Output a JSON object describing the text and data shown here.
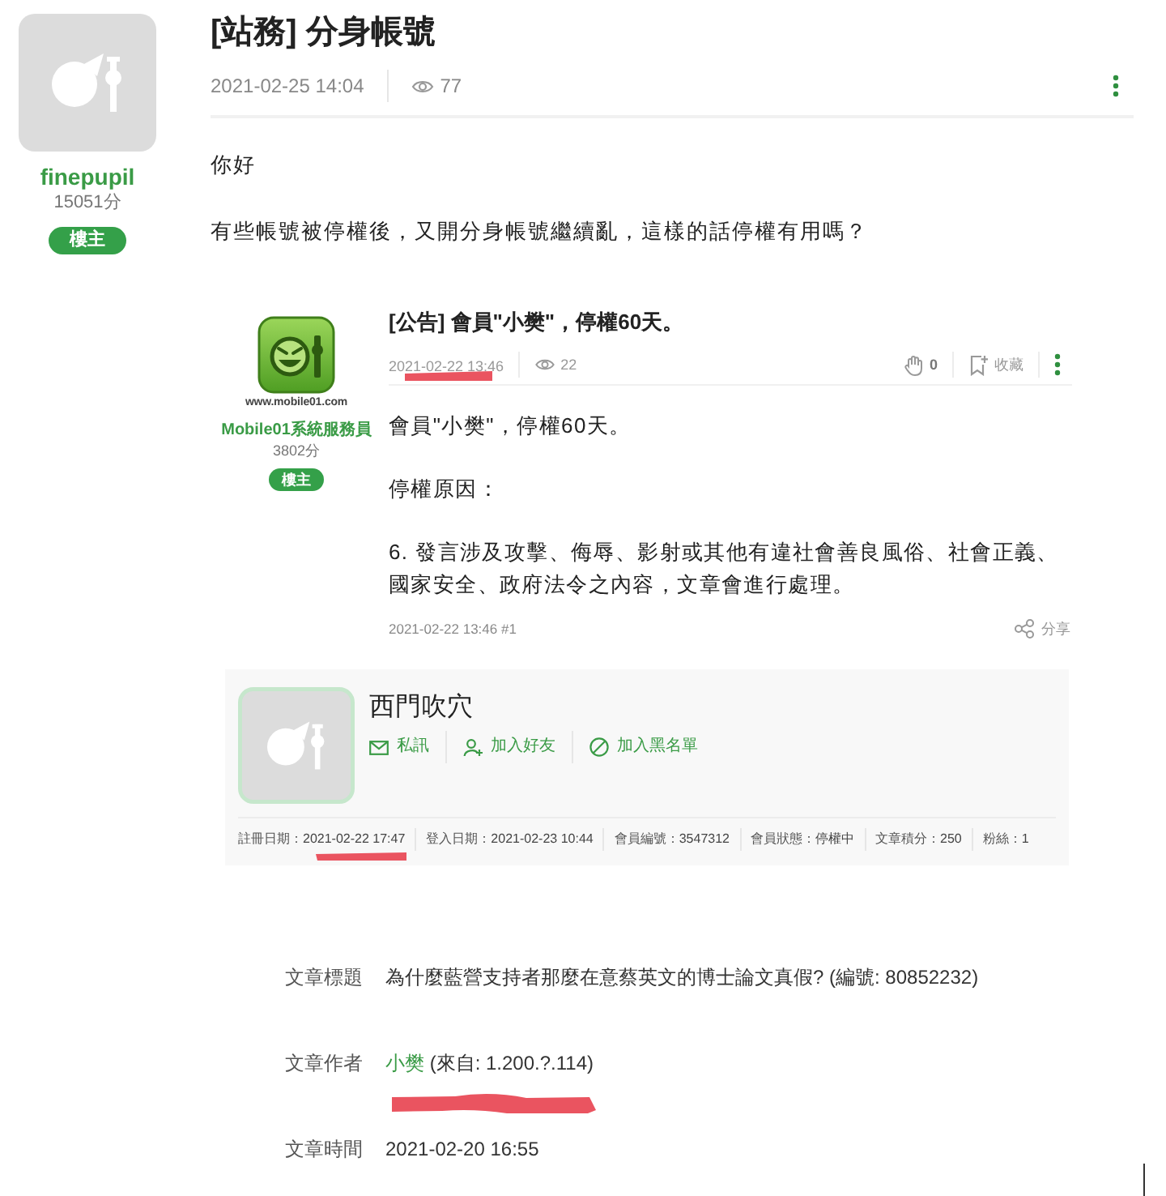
{
  "author": {
    "name": "finepupil",
    "points": "15051分",
    "badge": "樓主"
  },
  "post": {
    "title": "[站務] 分身帳號",
    "date": "2021-02-25 14:04",
    "views": "77",
    "paragraphs": [
      "你好",
      "有些帳號被停權後，又開分身帳號繼續亂，這樣的話停權有用嗎？"
    ]
  },
  "quoted_post": {
    "author": {
      "name": "Mobile01系統服務員",
      "logo_caption": "www.mobile01.com",
      "points": "3802分",
      "badge": "樓主"
    },
    "title": "[公告] 會員\"小樊\"，停權60天。",
    "date": "2021-02-22 13:46",
    "date_annotated": true,
    "views": "22",
    "likes": "0",
    "bookmark_label": "收藏",
    "paragraphs": [
      "會員\"小樊\"，停權60天。",
      "停權原因：",
      "6. 發言涉及攻擊、侮辱、影射或其他有違社會善良風俗、社會正義、國家安全、政府法令之內容，文章會進行處理。"
    ],
    "footer": "2021-02-22 13:46 #1",
    "share_label": "分享"
  },
  "profile_card": {
    "name": "西門吹穴",
    "actions": [
      {
        "kind": "message",
        "label": "私訊"
      },
      {
        "kind": "add_friend",
        "label": "加入好友"
      },
      {
        "kind": "block",
        "label": "加入黑名單"
      }
    ],
    "stats": [
      {
        "label": "註冊日期：",
        "value": "2021-02-22 17:47",
        "annotated": true
      },
      {
        "label": "登入日期：",
        "value": "2021-02-23 10:44",
        "annotated": false
      },
      {
        "label": "會員編號：",
        "value": "3547312",
        "annotated": false
      },
      {
        "label": "會員狀態：",
        "value": "停權中",
        "annotated": false
      },
      {
        "label": "文章積分：",
        "value": "250",
        "annotated": false
      },
      {
        "label": "粉絲：",
        "value": "1",
        "annotated": false
      }
    ]
  },
  "article_info": [
    {
      "kind": "text",
      "label": "文章標題",
      "value": "為什麼藍營支持者那麼在意蔡英文的博士論文真假? (編號: 80852232)",
      "annotated": false
    },
    {
      "kind": "author",
      "label": "文章作者",
      "link": "小樊",
      "value": " (來自: 1.200.?.114)",
      "annotated": true
    },
    {
      "kind": "text",
      "label": "文章時間",
      "value": "2021-02-20 16:55",
      "annotated": false
    }
  ]
}
